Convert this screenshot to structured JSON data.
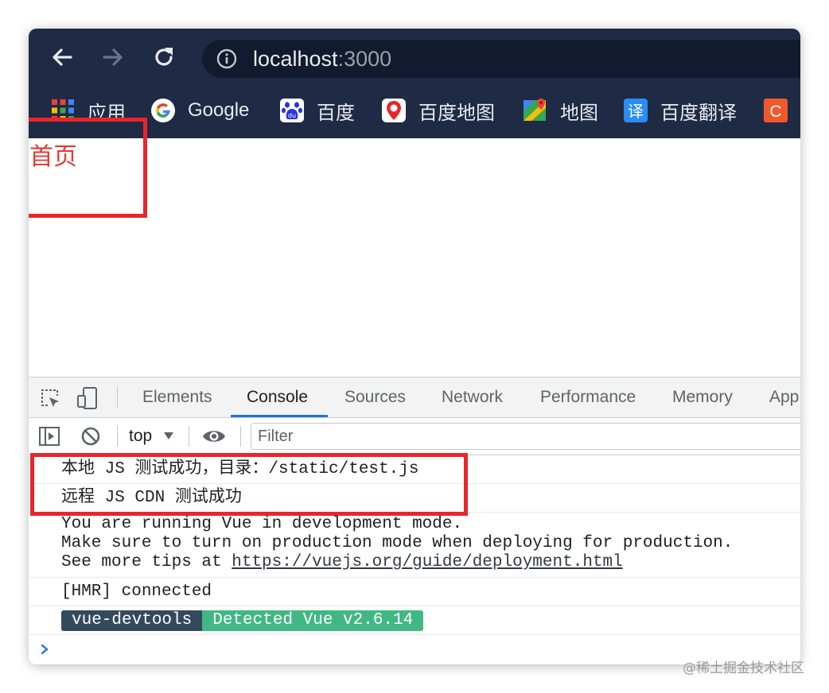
{
  "browser": {
    "url_host": "localhost",
    "url_port": ":3000",
    "nav": {
      "back": "arrow-left-icon",
      "forward": "arrow-right-icon",
      "reload": "reload-icon"
    },
    "bookmarks": [
      {
        "label": "应用",
        "icon": "apps-grid-icon"
      },
      {
        "label": "Google",
        "icon": "google-icon"
      },
      {
        "label": "百度",
        "icon": "baidu-paw-icon"
      },
      {
        "label": "百度地图",
        "icon": "baidu-map-icon"
      },
      {
        "label": "地图",
        "icon": "google-maps-icon"
      },
      {
        "label": "百度翻译",
        "icon": "baidu-translate-icon"
      },
      {
        "label": "",
        "icon": "c-letter-icon"
      }
    ],
    "baidu_icon_text": "du",
    "translate_icon_text": "译",
    "c_icon_text": "C"
  },
  "page": {
    "home_link": "首页"
  },
  "devtools": {
    "tabs": [
      "Elements",
      "Console",
      "Sources",
      "Network",
      "Performance",
      "Memory",
      "App"
    ],
    "active_tab": "Console",
    "context": "top",
    "filter_placeholder": "Filter",
    "console": {
      "messages": [
        "本地 JS 测试成功，目录：/static/test.js",
        "远程 JS CDN 测试成功"
      ],
      "vue_warning": {
        "line1": "You are running Vue in development mode.",
        "line2": "Make sure to turn on production mode when deploying for production.",
        "line3_prefix": "See more tips at ",
        "link": "https://vuejs.org/guide/deployment.html"
      },
      "hmr": "[HMR] connected",
      "devtools_badge_left": "vue-devtools",
      "devtools_badge_right": "Detected Vue v2.6.14"
    }
  },
  "colors": {
    "chrome_bg": "#1f2a45",
    "annotation_red": "#e8262a",
    "link_red": "#e53935",
    "tab_active_blue": "#1a73e8",
    "vue_dark": "#35495e",
    "vue_green": "#41b883"
  },
  "watermark": "@稀土掘金技术社区"
}
